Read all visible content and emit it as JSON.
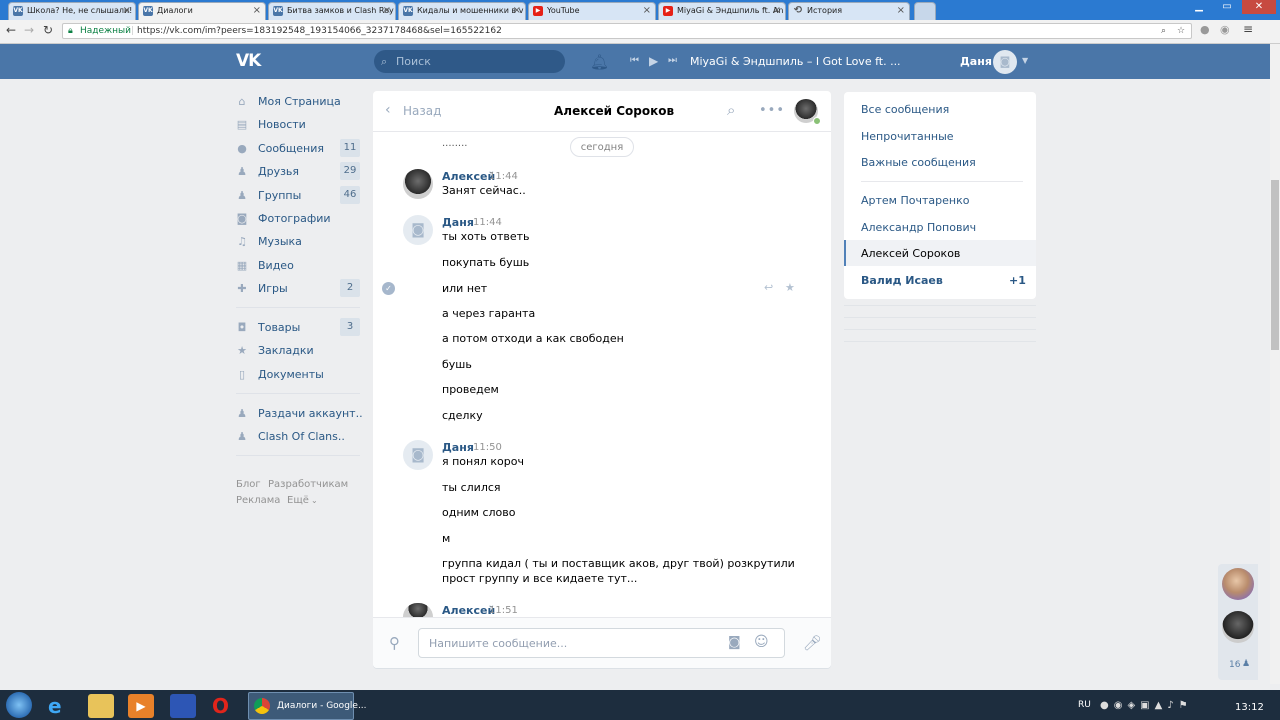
{
  "browser": {
    "tabs": [
      {
        "title": "Школа? Не, не слышали!",
        "fav": "VK",
        "active": false
      },
      {
        "title": "Диалоги",
        "fav": "VK",
        "active": true
      },
      {
        "title": "Битва замков и Clash Roy",
        "fav": "VK",
        "active": false
      },
      {
        "title": "Кидалы и мошенники в v",
        "fav": "VK",
        "active": false
      },
      {
        "title": "YouTube",
        "fav": "▶",
        "active": false
      },
      {
        "title": "MiyaGi & Эндшпиль ft. An",
        "fav": "▶",
        "active": false
      },
      {
        "title": "История",
        "fav": "⟲",
        "active": false
      }
    ],
    "secure_label": "Надежный",
    "url": "https://vk.com/im?peers=183192548_193154066_3237178468&sel=165522162"
  },
  "header": {
    "logo": "VK",
    "search_placeholder": "Поиск",
    "now_playing": "MiyaGi & Эндшпиль – I Got Love ft. ...",
    "user_name": "Даня"
  },
  "sidebar": {
    "items": [
      {
        "label": "Моя Страница",
        "icon": "home-icon",
        "glyph": "⌂",
        "badge": ""
      },
      {
        "label": "Новости",
        "icon": "news-icon",
        "glyph": "▤",
        "badge": ""
      },
      {
        "label": "Сообщения",
        "icon": "messages-icon",
        "glyph": "●",
        "badge": "11"
      },
      {
        "label": "Друзья",
        "icon": "friends-icon",
        "glyph": "♟",
        "badge": "29"
      },
      {
        "label": "Группы",
        "icon": "groups-icon",
        "glyph": "♟",
        "badge": "46"
      },
      {
        "label": "Фотографии",
        "icon": "camera-icon",
        "glyph": "◙",
        "badge": ""
      },
      {
        "label": "Музыка",
        "icon": "music-icon",
        "glyph": "♫",
        "badge": ""
      },
      {
        "label": "Видео",
        "icon": "video-icon",
        "glyph": "▦",
        "badge": ""
      },
      {
        "label": "Игры",
        "icon": "games-icon",
        "glyph": "✚",
        "badge": "2"
      },
      {
        "label": "Товары",
        "icon": "market-icon",
        "glyph": "◘",
        "badge": "3"
      },
      {
        "label": "Закладки",
        "icon": "bookmark-star-icon",
        "glyph": "★",
        "badge": ""
      },
      {
        "label": "Документы",
        "icon": "documents-icon",
        "glyph": "▯",
        "badge": ""
      },
      {
        "label": "Раздачи аккаунт..",
        "icon": "group-icon",
        "glyph": "♟",
        "badge": ""
      },
      {
        "label": "Clash Of Clans..",
        "icon": "group-icon",
        "glyph": "♟",
        "badge": ""
      }
    ],
    "footer": {
      "blog": "Блог",
      "developers": "Разработчикам",
      "ads": "Реклама",
      "more": "Ещё"
    }
  },
  "chat": {
    "back_label": "Назад",
    "title": "Алексей Сороков",
    "top_dots": "........",
    "date_separator": "сегодня",
    "groups": [
      {
        "author": "Алексей",
        "time": "11:44",
        "avatar": "dark",
        "messages": [
          "Занят сейчас.."
        ]
      },
      {
        "author": "Даня",
        "time": "11:44",
        "avatar": "camera",
        "messages": [
          "ты хоть ответь",
          "покупать бушь",
          "или нет",
          "а через гаранта",
          "а потом отходи а как свободен",
          "бушь",
          "проведем",
          "сделку"
        ]
      },
      {
        "author": "Даня",
        "time": "11:50",
        "avatar": "camera",
        "messages": [
          "я понял короч",
          "ты слился",
          "одним слово",
          "м",
          "группа кидал ( ты и поставщик аков, друг твой) розкрутили",
          "прост группу и все кидаете тут..."
        ]
      },
      {
        "author": "Алексей",
        "time": "11:51",
        "avatar": "dark",
        "messages": []
      }
    ],
    "input_placeholder": "Напишите сообщение..."
  },
  "right_panel": {
    "filters": [
      "Все сообщения",
      "Непрочитанные",
      "Важные сообщения"
    ],
    "dialogs": [
      {
        "name": "Артем Почтаренко",
        "selected": false,
        "unread": false,
        "count": ""
      },
      {
        "name": "Александр Попович",
        "selected": false,
        "unread": false,
        "count": ""
      },
      {
        "name": "Алексей Сороков",
        "selected": true,
        "unread": false,
        "count": ""
      },
      {
        "name": "Валид Исаев",
        "selected": false,
        "unread": true,
        "count": "+1"
      }
    ]
  },
  "online": {
    "count": "16"
  },
  "taskbar": {
    "active_window": "Диалоги - Google...",
    "lang": "RU",
    "clock": "13:12"
  },
  "colors": {
    "vk_blue": "#4a76a8",
    "link": "#2a5885",
    "bg": "#edeef0"
  }
}
